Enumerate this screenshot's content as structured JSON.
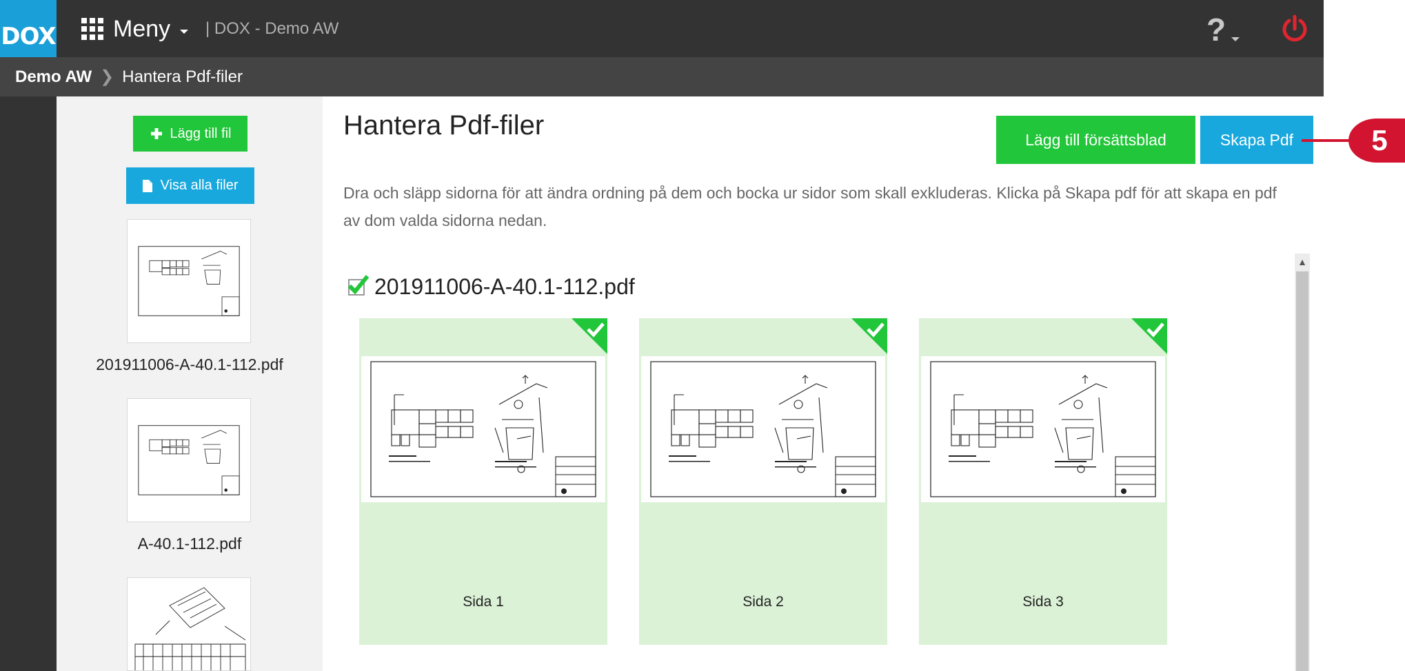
{
  "header": {
    "logo": "DOX",
    "menu_label": "Meny",
    "app_name": "| DOX - Demo AW",
    "help_label": "?"
  },
  "breadcrumb": {
    "root": "Demo AW",
    "current": "Hantera Pdf-filer"
  },
  "sidebar": {
    "add_file_label": "Lägg till fil",
    "show_all_label": "Visa alla filer",
    "files": [
      {
        "name": "201911006-A-40.1-112.pdf"
      },
      {
        "name": "A-40.1-112.pdf"
      }
    ]
  },
  "main": {
    "title": "Hantera Pdf-filer",
    "add_cover_label": "Lägg till försättsblad",
    "create_pdf_label": "Skapa Pdf",
    "description": "Dra och släpp sidorna för att ändra ordning på dem och bocka ur sidor som skall exkluderas. Klicka på Skapa pdf för att skapa en pdf av dom valda sidorna nedan.",
    "file_title": "201911006-A-40.1-112.pdf",
    "pages": [
      {
        "label": "Sida 1",
        "selected": true
      },
      {
        "label": "Sida 2",
        "selected": true
      },
      {
        "label": "Sida 3",
        "selected": true
      }
    ]
  },
  "annotation": {
    "number": "5"
  },
  "colors": {
    "accent_blue": "#1a9fd8",
    "green": "#22c63a",
    "power_red": "#e0252f",
    "marker_red": "#d31430",
    "card_bg": "#dbf2d7"
  }
}
